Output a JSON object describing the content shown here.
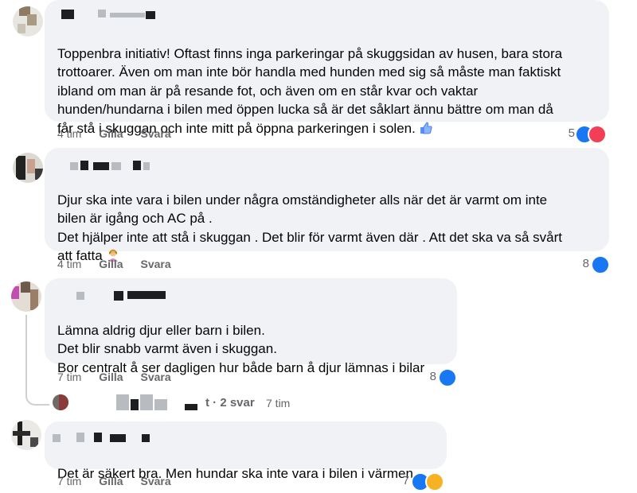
{
  "comments": [
    {
      "name": "",
      "text": "Toppenbra initiativ! Oftast finns inga parkeringar på skuggsidan av husen, bara stora\ntrottoarer. Även om man inte bör handla med hunden med sig så måste man faktiskt\nibland om man är på resande fot, och även om en står kvar och vaktar\nhunden/hundarna i bilen med öppen lucka så är det såklart ännu bättre om man då\nfår stå i skuggan och inte mitt på öppna parkeringen i solen.",
      "emoji": "thumbs-up",
      "time": "4 tim",
      "like_label": "Gilla",
      "reply_label": "Svara",
      "reaction_count": "5",
      "reactions": [
        "like",
        "love"
      ]
    },
    {
      "name": "",
      "text": "Djur ska inte vara i bilen under några omständigheter alls när det är varmt om inte\nbilen är igång och AC på .\nDet hjälper inte att stå i skuggan . Det blir för varmt även där . Att det ska va så svårt\natt fatta",
      "emoji": "person-facepalming",
      "time": "4 tim",
      "like_label": "Gilla",
      "reply_label": "Svara",
      "reaction_count": "8",
      "reactions": [
        "like"
      ]
    },
    {
      "name": "",
      "text": "Lämna aldrig djur eller barn i bilen.\nDet blir snabb varmt även i skuggan.\nBor centralt å ser dagligen hur både barn å djur lämnas i bilar",
      "time": "7 tim",
      "like_label": "Gilla",
      "reply_label": "Svara",
      "reaction_count": "8",
      "reactions": [
        "like"
      ]
    },
    {
      "name": "",
      "text": "Det är säkert bra. Men hundar ska inte vara i bilen i värmen.",
      "time": "7 tim",
      "like_label": "Gilla",
      "reply_label": "Svara",
      "reaction_count": "7",
      "reactions": [
        "like",
        "haha"
      ]
    }
  ],
  "replies_link": {
    "label": "t · 2 svar",
    "time": "7 tim"
  },
  "colors": {
    "bubble": "#f0f2f5",
    "meta_text": "#65676b",
    "like_blue": "#1877f2",
    "love_red": "#f33e58",
    "haha_yellow": "#f7b125"
  }
}
